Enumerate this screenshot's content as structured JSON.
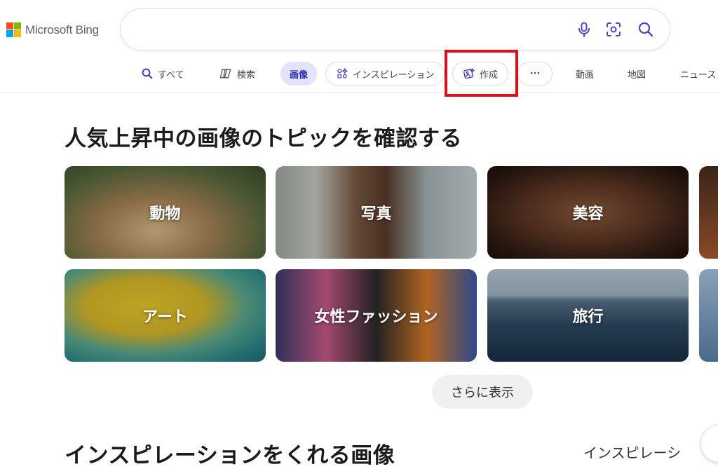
{
  "header": {
    "logo_text": "Microsoft Bing",
    "search": {
      "value": "",
      "placeholder": ""
    },
    "icons": [
      "microphone-icon",
      "visual-search-icon",
      "search-icon"
    ]
  },
  "tabs": [
    {
      "id": "all",
      "label": "すべて",
      "icon": "search-icon"
    },
    {
      "id": "copilot",
      "label": "検索",
      "icon": "copilot-icon"
    },
    {
      "id": "images",
      "label": "画像",
      "active": true
    },
    {
      "id": "inspiration",
      "label": "インスピレーション",
      "icon": "inspiration-icon"
    },
    {
      "id": "create",
      "label": "作成",
      "icon": "create-image-icon",
      "highlighted": true
    },
    {
      "id": "more",
      "label": "···"
    },
    {
      "id": "videos",
      "label": "動画"
    },
    {
      "id": "maps",
      "label": "地図"
    },
    {
      "id": "news",
      "label": "ニュース"
    }
  ],
  "trending": {
    "title": "人気上昇中の画像のトピックを確認する",
    "cards": [
      {
        "label": "動物"
      },
      {
        "label": "写真"
      },
      {
        "label": "美容"
      },
      {
        "label": "アート"
      },
      {
        "label": "女性ファッション"
      },
      {
        "label": "旅行"
      }
    ],
    "more_button": "さらに表示"
  },
  "inspiration": {
    "title": "インスピレーションをくれる画像",
    "right_link": "インスピレーシ"
  },
  "colors": {
    "accent": "#2b2bb0",
    "active_tab_bg": "#e3e3fb",
    "highlight_border": "#d8101a",
    "ms_red": "#f25022",
    "ms_green": "#7fba00",
    "ms_blue": "#00a4ef",
    "ms_yellow": "#ffb900"
  }
}
